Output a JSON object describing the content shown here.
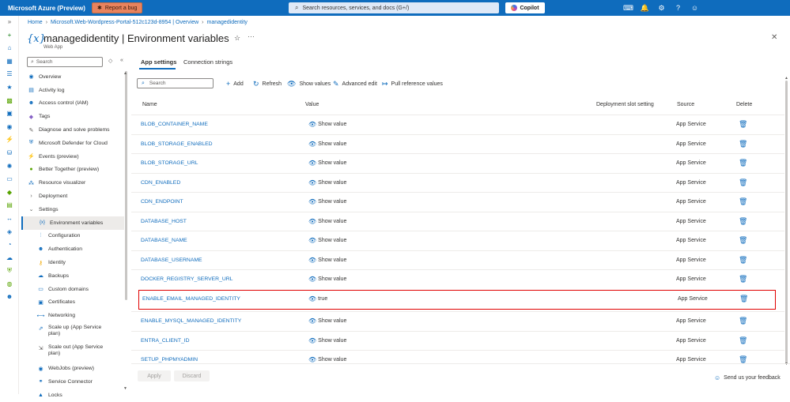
{
  "topbar": {
    "brand": "Microsoft Azure (Preview)",
    "report_bug": "Report a bug",
    "search_placeholder": "Search resources, services, and docs (G+/)",
    "copilot": "Copilot",
    "bar_color": "#0f6cbd"
  },
  "breadcrumb": {
    "items": [
      "Home",
      "Microsoft.Web-Wordpress-Portal-512c123d-8954 | Overview",
      "managedidentity"
    ]
  },
  "header": {
    "title": "managedidentity | Environment variables",
    "subtitle": "Web App"
  },
  "sidebar": {
    "search_placeholder": "Search",
    "items": [
      {
        "label": "Overview"
      },
      {
        "label": "Activity log"
      },
      {
        "label": "Access control (IAM)"
      },
      {
        "label": "Tags"
      },
      {
        "label": "Diagnose and solve problems"
      },
      {
        "label": "Microsoft Defender for Cloud"
      },
      {
        "label": "Events (preview)"
      },
      {
        "label": "Better Together (preview)"
      },
      {
        "label": "Resource visualizer"
      },
      {
        "label": "Deployment"
      },
      {
        "label": "Settings"
      },
      {
        "label": "Environment variables"
      },
      {
        "label": "Configuration"
      },
      {
        "label": "Authentication"
      },
      {
        "label": "Identity"
      },
      {
        "label": "Backups"
      },
      {
        "label": "Custom domains"
      },
      {
        "label": "Certificates"
      },
      {
        "label": "Networking"
      },
      {
        "label": "Scale up (App Service plan)"
      },
      {
        "label": "Scale out (App Service plan)"
      },
      {
        "label": "WebJobs (preview)"
      },
      {
        "label": "Service Connector"
      },
      {
        "label": "Locks"
      }
    ]
  },
  "tabs": {
    "app_settings": "App settings",
    "connection_strings": "Connection strings"
  },
  "toolbar": {
    "search_placeholder": "Search",
    "add": "Add",
    "refresh": "Refresh",
    "show_values": "Show values",
    "advanced_edit": "Advanced edit",
    "pull_reference": "Pull reference values"
  },
  "table": {
    "headers": {
      "name": "Name",
      "value": "Value",
      "slot": "Deployment slot setting",
      "source": "Source",
      "delete": "Delete"
    },
    "rows": [
      {
        "name": "BLOB_CONTAINER_NAME",
        "value": "Show value",
        "source": "App Service"
      },
      {
        "name": "BLOB_STORAGE_ENABLED",
        "value": "Show value",
        "source": "App Service"
      },
      {
        "name": "BLOB_STORAGE_URL",
        "value": "Show value",
        "source": "App Service"
      },
      {
        "name": "CDN_ENABLED",
        "value": "Show value",
        "source": "App Service"
      },
      {
        "name": "CDN_ENDPOINT",
        "value": "Show value",
        "source": "App Service"
      },
      {
        "name": "DATABASE_HOST",
        "value": "Show value",
        "source": "App Service"
      },
      {
        "name": "DATABASE_NAME",
        "value": "Show value",
        "source": "App Service"
      },
      {
        "name": "DATABASE_USERNAME",
        "value": "Show value",
        "source": "App Service"
      },
      {
        "name": "DOCKER_REGISTRY_SERVER_URL",
        "value": "Show value",
        "source": "App Service"
      },
      {
        "name": "ENABLE_EMAIL_MANAGED_IDENTITY",
        "value": "true",
        "source": "App Service"
      },
      {
        "name": "ENABLE_MYSQL_MANAGED_IDENTITY",
        "value": "Show value",
        "source": "App Service"
      },
      {
        "name": "ENTRA_CLIENT_ID",
        "value": "Show value",
        "source": "App Service"
      },
      {
        "name": "SETUP_PHPMYADMIN",
        "value": "Show value",
        "source": "App Service"
      }
    ]
  },
  "footer": {
    "apply": "Apply",
    "discard": "Discard",
    "feedback": "Send us your feedback"
  }
}
